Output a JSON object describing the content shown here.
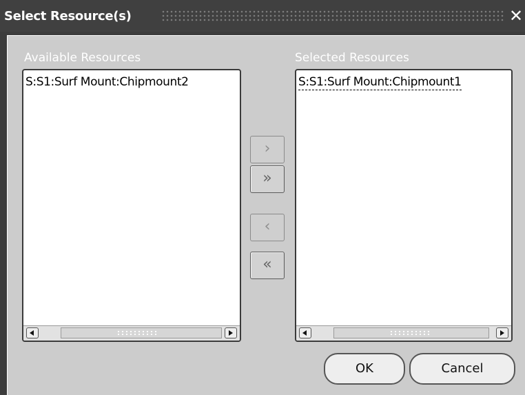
{
  "window": {
    "title": "Select Resource(s)",
    "close_icon": "close-icon"
  },
  "available": {
    "label": "Available Resources",
    "items": [
      "S:S1:Surf Mount:Chipmount2"
    ]
  },
  "selected": {
    "label": "Selected Resources",
    "items": [
      "S:S1:Surf Mount:Chipmount1"
    ]
  },
  "shuttle": {
    "move": "›",
    "move_all": "»",
    "remove": "‹",
    "remove_all": "«"
  },
  "buttons": {
    "ok": "OK",
    "cancel": "Cancel"
  },
  "colors": {
    "title_bar": "#404040",
    "client_bg": "#cccccc",
    "list_bg": "#ffffff"
  }
}
